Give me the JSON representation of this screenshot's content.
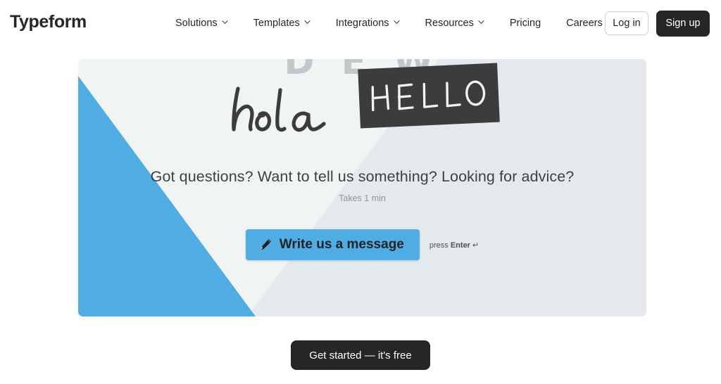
{
  "brand": {
    "logo_text": "Typeform",
    "accent_blue": "#4fade4",
    "dark": "#262627",
    "panel_mint": "#f0f5f4",
    "panel_gray": "#e4e9ed",
    "hello_box": "#3c3c3c"
  },
  "nav": {
    "items": [
      {
        "label": "Solutions",
        "has_caret": true
      },
      {
        "label": "Templates",
        "has_caret": true
      },
      {
        "label": "Integrations",
        "has_caret": true
      },
      {
        "label": "Resources",
        "has_caret": true
      },
      {
        "label": "Pricing",
        "has_caret": false
      },
      {
        "label": "Careers",
        "has_caret": false
      }
    ],
    "login_label": "Log in",
    "signup_label": "Sign up"
  },
  "hero": {
    "faded_top_text": "D   E   W",
    "script_word": "hola",
    "block_word": "HELLO",
    "question": "Got questions? Want to tell us something? Looking for advice?",
    "duration": "Takes 1 min",
    "cta_label": "Write us a message",
    "cta_icon": "pencil-icon",
    "press_prefix": "press",
    "press_key": "Enter",
    "press_return_glyph": "↵"
  },
  "footer": {
    "get_started_label": "Get started — it's free"
  }
}
